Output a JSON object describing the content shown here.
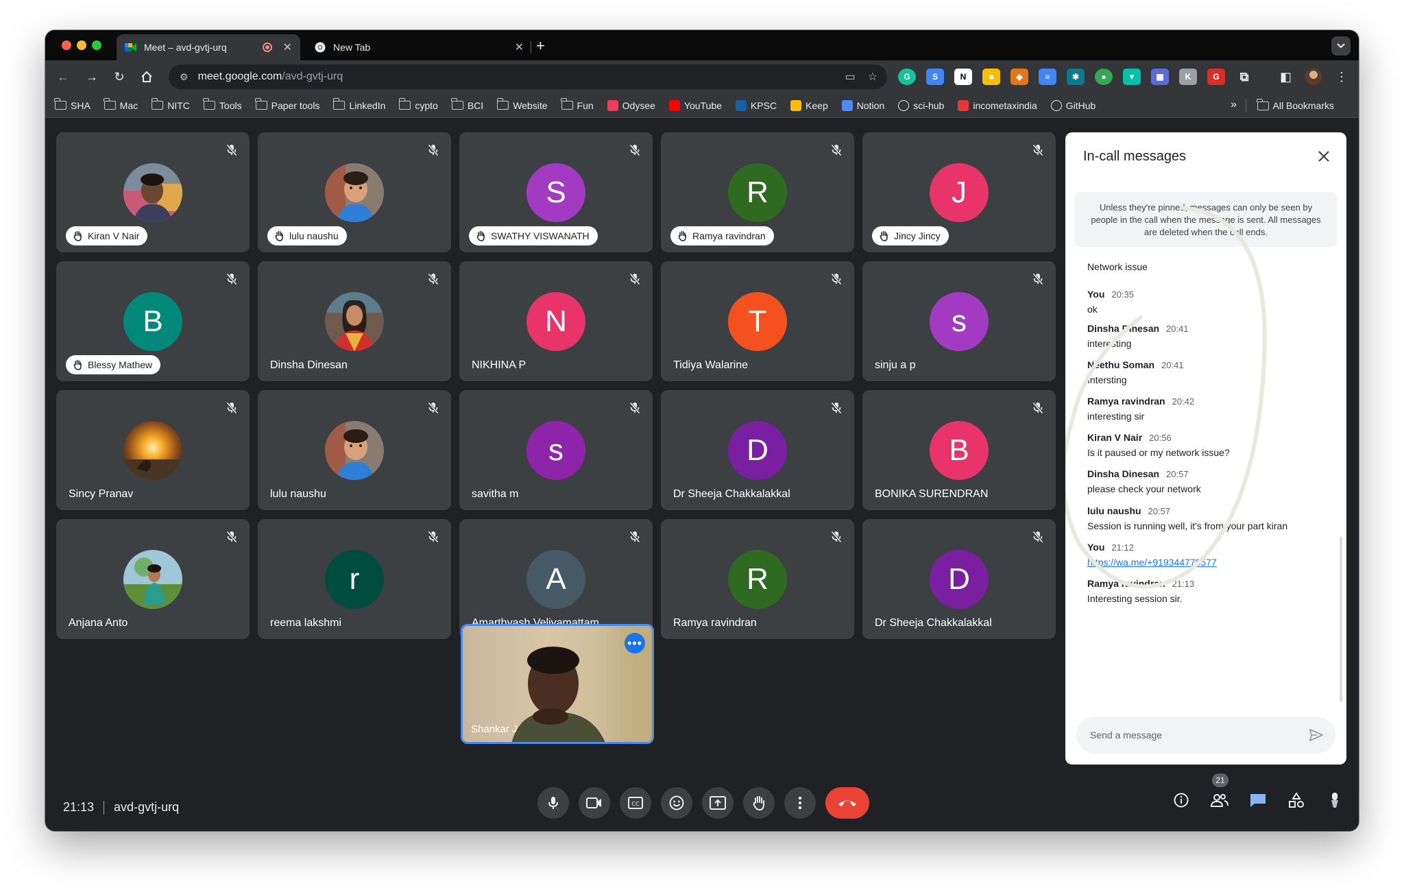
{
  "browser": {
    "tabs": [
      {
        "title": "Meet – avd-gvtj-urq",
        "active": true
      },
      {
        "title": "New Tab",
        "active": false
      }
    ],
    "new_tab_glyph": "+",
    "url_host": "meet.google.com",
    "url_path": "/avd-gvtj-urq",
    "bookmarks": [
      {
        "label": "SHA",
        "icon": "folder-icon"
      },
      {
        "label": "Mac",
        "icon": "folder-icon"
      },
      {
        "label": "NITC",
        "icon": "folder-icon"
      },
      {
        "label": "Tools",
        "icon": "folder-icon"
      },
      {
        "label": "Paper tools",
        "icon": "folder-icon"
      },
      {
        "label": "LinkedIn",
        "icon": "folder-icon"
      },
      {
        "label": "cypto",
        "icon": "folder-icon"
      },
      {
        "label": "BCI",
        "icon": "folder-icon"
      },
      {
        "label": "Website",
        "icon": "folder-icon"
      },
      {
        "label": "Fun",
        "icon": "folder-icon"
      },
      {
        "label": "Odysee",
        "icon": "odysee-icon",
        "color": "#ef3e5b"
      },
      {
        "label": "YouTube",
        "icon": "youtube-icon",
        "color": "#ff0000"
      },
      {
        "label": "KPSC",
        "icon": "kpsc-icon",
        "color": "#1b5ea8"
      },
      {
        "label": "Keep",
        "icon": "keep-icon",
        "color": "#fbbc04"
      },
      {
        "label": "Notion",
        "icon": "notion-icon",
        "color": "#4c8bf5"
      },
      {
        "label": "sci-hub",
        "icon": "scihub-icon",
        "color": "#ffffff"
      },
      {
        "label": "incometaxindia",
        "icon": "incometax-icon",
        "color": "#e53935"
      },
      {
        "label": "GitHub",
        "icon": "github-icon",
        "color": "#ffffff"
      }
    ],
    "all_bookmarks_label": "All Bookmarks",
    "more_glyph": "»"
  },
  "meeting": {
    "time": "21:13",
    "code": "avd-gvtj-urq",
    "participant_count": "21",
    "tiles": [
      {
        "name": "Kiran V Nair",
        "hand": true,
        "kind": "photo",
        "photo": "kiran"
      },
      {
        "name": "lulu naushu",
        "hand": true,
        "kind": "photo",
        "photo": "child"
      },
      {
        "name": "SWATHY VISWANATH",
        "hand": true,
        "kind": "letter",
        "letter": "S",
        "color": "#a33bc2"
      },
      {
        "name": "Ramya ravindran",
        "hand": true,
        "kind": "letter",
        "letter": "R",
        "color": "#2e6b21"
      },
      {
        "name": "Jincy Jincy",
        "hand": true,
        "kind": "letter",
        "letter": "J",
        "color": "#e8336b"
      },
      {
        "name": "Blessy Mathew",
        "hand": true,
        "kind": "letter",
        "letter": "B",
        "color": "#00897b"
      },
      {
        "name": "Dinsha Dinesan",
        "hand": false,
        "kind": "photo",
        "photo": "dinsha"
      },
      {
        "name": "NIKHINA P",
        "hand": false,
        "kind": "letter",
        "letter": "N",
        "color": "#e8336b"
      },
      {
        "name": "Tidiya Walarine",
        "hand": false,
        "kind": "letter",
        "letter": "T",
        "color": "#f4511e"
      },
      {
        "name": "sinju a p",
        "hand": false,
        "kind": "letter",
        "letter": "s",
        "color": "#a33bc2"
      },
      {
        "name": "Sincy Pranav",
        "hand": false,
        "kind": "photo",
        "photo": "sunset"
      },
      {
        "name": "lulu naushu",
        "hand": false,
        "kind": "photo",
        "photo": "child"
      },
      {
        "name": "savitha m",
        "hand": false,
        "kind": "letter",
        "letter": "s",
        "color": "#8e24aa"
      },
      {
        "name": "Dr Sheeja Chakkalakkal",
        "hand": false,
        "kind": "letter",
        "letter": "D",
        "color": "#7b1fa2"
      },
      {
        "name": "BONIKA SURENDRAN",
        "hand": false,
        "kind": "letter",
        "letter": "B",
        "color": "#e8336b"
      },
      {
        "name": "Anjana Anto",
        "hand": false,
        "kind": "photo",
        "photo": "anjana"
      },
      {
        "name": "reema lakshmi",
        "hand": false,
        "kind": "letter",
        "letter": "r",
        "color": "#004d40"
      },
      {
        "name": "Amarthyash Veliyamattam",
        "hand": false,
        "kind": "letter",
        "letter": "A",
        "color": "#455a64"
      },
      {
        "name": "Ramya ravindran",
        "hand": false,
        "kind": "letter",
        "letter": "R",
        "color": "#2e6b21"
      },
      {
        "name": "Dr Sheeja Chakkalakkal",
        "hand": false,
        "kind": "letter",
        "letter": "D",
        "color": "#7b1fa2"
      }
    ],
    "self_name": "Shankar J"
  },
  "chat": {
    "title": "In-call messages",
    "notice": "Unless they're pinned, messages can only be seen by people in the call when the message is sent. All messages are deleted when the call ends.",
    "messages": [
      {
        "who": "",
        "time": "",
        "text": "Network issue"
      },
      {
        "who": "You",
        "time": "20:35",
        "text": "ok"
      },
      {
        "who": "Dinsha Dinesan",
        "time": "20:41",
        "text": "interesting"
      },
      {
        "who": "Neethu Soman",
        "time": "20:41",
        "text": "Intersting"
      },
      {
        "who": "Ramya ravindran",
        "time": "20:42",
        "text": "interesting sir"
      },
      {
        "who": "Kiran V Nair",
        "time": "20:56",
        "text": "Is it paused or my network issue?"
      },
      {
        "who": "Dinsha Dinesan",
        "time": "20:57",
        "text": "please check your network"
      },
      {
        "who": "lulu naushu",
        "time": "20:57",
        "text": "Session is running well, it's from your part kiran"
      },
      {
        "who": "You",
        "time": "21:12",
        "text": "https://wa.me/+919344775577",
        "link": true
      },
      {
        "who": "Ramya ravindran",
        "time": "21:13",
        "text": "Interesting session sir."
      }
    ],
    "input_placeholder": "Send a message"
  },
  "colors": {
    "accent_blue": "#1a73e8",
    "end_call_red": "#ea4335",
    "tile_bg": "#3c4043",
    "page_bg": "#202124"
  }
}
